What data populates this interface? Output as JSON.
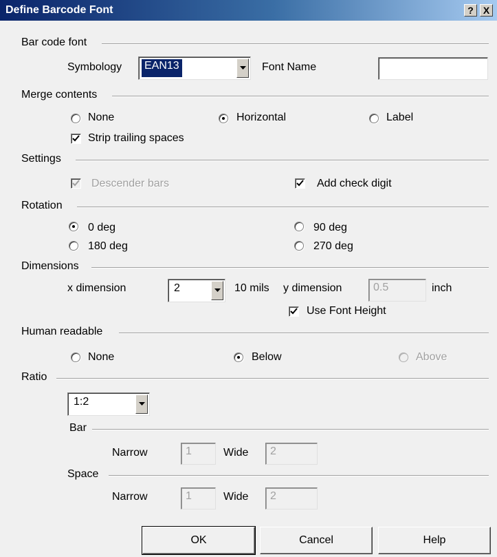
{
  "window": {
    "title": "Define Barcode Font",
    "help_caption": "?",
    "close_caption": "X"
  },
  "barcode_font": {
    "group_label": "Bar code font",
    "symbology_label": "Symbology",
    "symbology_value": "EAN13",
    "font_name_label": "Font Name",
    "font_name_value": ""
  },
  "merge_contents": {
    "group_label": "Merge contents",
    "options": [
      "None",
      "Horizontal",
      "Label"
    ],
    "selected": "Horizontal",
    "strip_label": "Strip trailing spaces",
    "strip_checked": true
  },
  "settings": {
    "group_label": "Settings",
    "descender_label": "Descender bars",
    "descender_checked": true,
    "descender_enabled": false,
    "check_digit_label": "Add check digit",
    "check_digit_checked": true
  },
  "rotation": {
    "group_label": "Rotation",
    "options": [
      "0 deg",
      "90 deg",
      "180 deg",
      "270 deg"
    ],
    "selected": "0 deg"
  },
  "dimensions": {
    "group_label": "Dimensions",
    "x_label": "x dimension",
    "x_value": "2",
    "x_unit": "10 mils",
    "y_label": "y dimension",
    "y_value": "0.5",
    "y_unit": "inch",
    "use_font_height_label": "Use Font Height",
    "use_font_height_checked": true
  },
  "human_readable": {
    "group_label": "Human readable",
    "options": [
      "None",
      "Below",
      "Above"
    ],
    "selected": "Below"
  },
  "ratio": {
    "group_label": "Ratio",
    "value": "1:2",
    "bar_label": "Bar",
    "space_label": "Space",
    "narrow_label": "Narrow",
    "wide_label": "Wide",
    "bar_narrow": "1",
    "bar_wide": "2",
    "space_narrow": "1",
    "space_wide": "2"
  },
  "buttons": {
    "ok": "OK",
    "cancel": "Cancel",
    "help": "Help"
  }
}
